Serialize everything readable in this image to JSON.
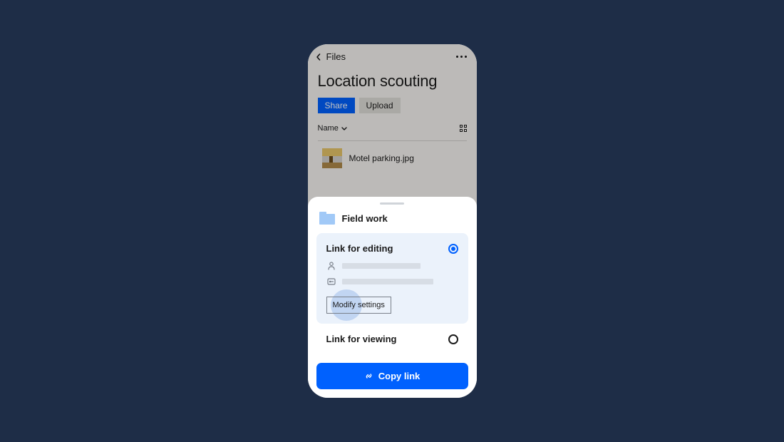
{
  "nav": {
    "back_label": "Files"
  },
  "page": {
    "title": "Location scouting"
  },
  "actions": {
    "share_label": "Share",
    "upload_label": "Upload"
  },
  "sort": {
    "label": "Name"
  },
  "file_row": {
    "name": "Motel parking.jpg"
  },
  "sheet": {
    "folder_name": "Field work",
    "option_edit": {
      "title": "Link for editing",
      "modify_label": "Modify settings",
      "selected": true
    },
    "option_view": {
      "title": "Link for viewing",
      "selected": false
    },
    "copy_label": "Copy link"
  },
  "colors": {
    "background": "#1e2d47",
    "primary": "#0061fe",
    "folder": "#a1c9f7",
    "card_bg": "#ebf2fb"
  }
}
